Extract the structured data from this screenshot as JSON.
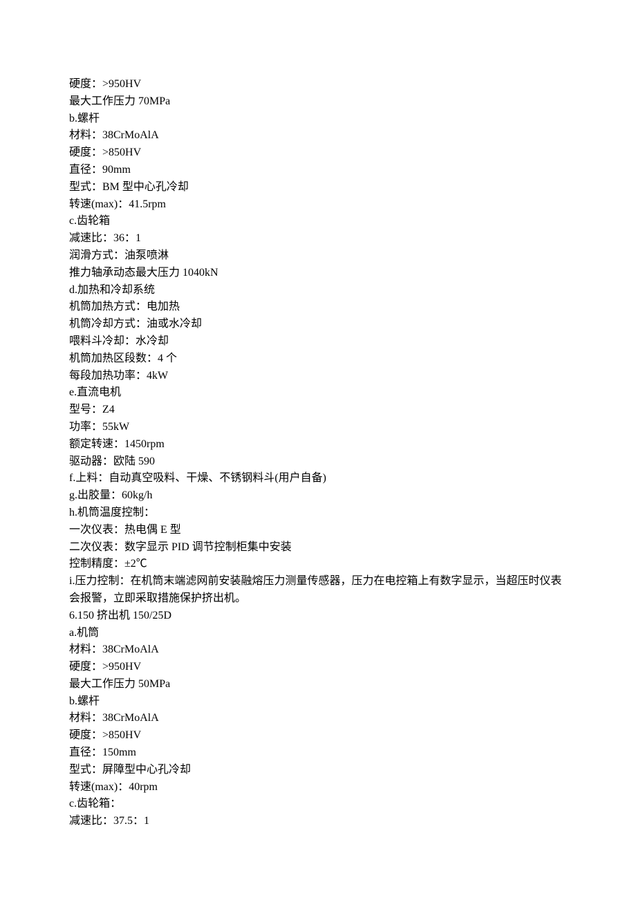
{
  "lines": [
    "硬度：>950HV",
    "最大工作压力 70MPa",
    "b.螺杆",
    "材料：38CrMoAlA",
    "硬度：>850HV",
    "直径：90mm",
    "型式：BM 型中心孔冷却",
    "转速(max)：41.5rpm",
    "c.齿轮箱",
    "减速比：36：1",
    "润滑方式：油泵喷淋",
    "推力轴承动态最大压力 1040kN",
    "d.加热和冷却系统",
    "机筒加热方式：电加热",
    "机筒冷却方式：油或水冷却",
    "喂料斗冷却：水冷却",
    "机筒加热区段数：4 个",
    "每段加热功率：4kW",
    "e.直流电机",
    "型号：Z4",
    "功率：55kW",
    "额定转速：1450rpm",
    "驱动器：欧陆 590",
    "f.上料：自动真空吸料、干燥、不锈钢料斗(用户自备)",
    "g.出胶量：60kg/h",
    "h.机筒温度控制：",
    "一次仪表：热电偶 E 型",
    "二次仪表：数字显示 PID 调节控制柜集中安装",
    "控制精度：±2℃",
    "i.压力控制：在机筒末端滤网前安装融熔压力测量传感器，压力在电控箱上有数字显示，当超压时仪表会报警，立即采取措施保护挤出机。",
    "6.150 挤出机 150/25D",
    "a.机筒",
    "材料：38CrMoAlA",
    "硬度：>950HV",
    "最大工作压力 50MPa",
    "b.螺杆",
    "材料：38CrMoAlA",
    "硬度：>850HV",
    "直径：150mm",
    "型式：屏障型中心孔冷却",
    "转速(max)：40rpm",
    "c.齿轮箱：",
    "减速比：37.5：1"
  ]
}
